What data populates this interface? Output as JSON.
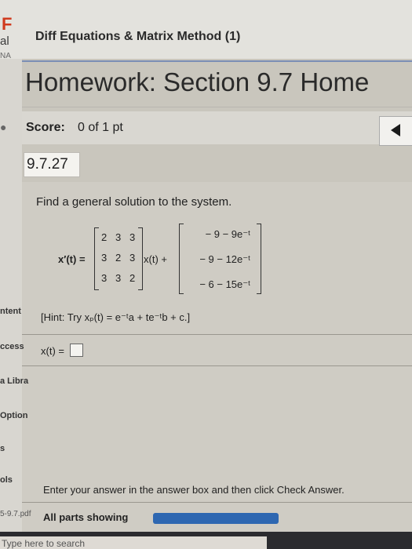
{
  "header": {
    "logo_letter": "F",
    "side_text_al": "al",
    "side_text_na": "NA",
    "course_title": "Diff Equations & Matrix Method (1)"
  },
  "homework_title": "Homework: Section 9.7 Home",
  "score": {
    "label": "Score:",
    "value": "0 of 1 pt"
  },
  "question_number": "9.7.27",
  "prompt": "Find a general solution to the system.",
  "equation": {
    "lhs": "x′(t) =",
    "matrix": [
      [
        "2",
        "3",
        "3"
      ],
      [
        "3",
        "2",
        "3"
      ],
      [
        "3",
        "3",
        "2"
      ]
    ],
    "times": "x(t) +",
    "vector": [
      "− 9 − 9e⁻ᵗ",
      "− 9 − 12e⁻ᵗ",
      "− 6 − 15e⁻ᵗ"
    ]
  },
  "hint": "[Hint: Try xₚ(t) = e⁻ᵗa + te⁻ᵗb + c.]",
  "answer": {
    "label": "x(t) =",
    "placeholder": ""
  },
  "sidebar_labels": [
    "ntent",
    "ccess",
    "a Libra",
    "Option",
    "s",
    "ols"
  ],
  "instruction": "Enter your answer in the answer box and then click Check Answer.",
  "parts_showing": "All parts showing",
  "progress": 1.0,
  "pdf_label": "5-9.7.pdf",
  "search_text": "Type here to search",
  "colors": {
    "accent": "#2e67b1",
    "logo": "#d03a1e"
  }
}
